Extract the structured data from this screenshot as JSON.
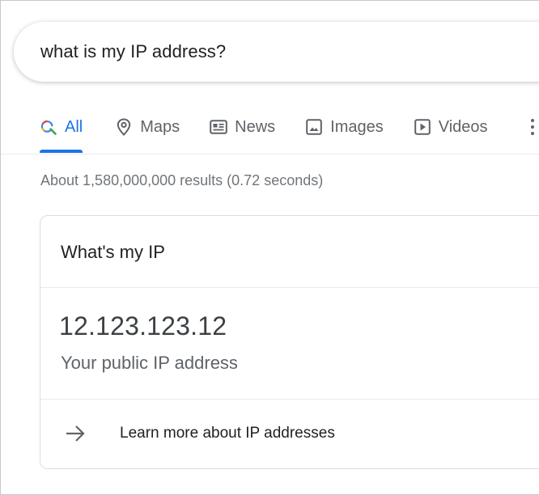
{
  "search": {
    "query": "what is my IP address?"
  },
  "tabs": [
    {
      "label": "All",
      "icon": "search-icon",
      "active": true
    },
    {
      "label": "Maps",
      "icon": "map-pin-icon",
      "active": false
    },
    {
      "label": "News",
      "icon": "news-icon",
      "active": false
    },
    {
      "label": "Images",
      "icon": "image-icon",
      "active": false
    },
    {
      "label": "Videos",
      "icon": "video-icon",
      "active": false
    }
  ],
  "results": {
    "stats": "About 1,580,000,000 results (0.72 seconds)"
  },
  "card": {
    "title": "What's my IP",
    "ip": "12.123.123.12",
    "caption": "Your public IP address",
    "learn_more": "Learn more about IP addresses"
  },
  "colors": {
    "accent": "#1a73e8",
    "muted": "#5f6368",
    "border": "#dadce0"
  }
}
